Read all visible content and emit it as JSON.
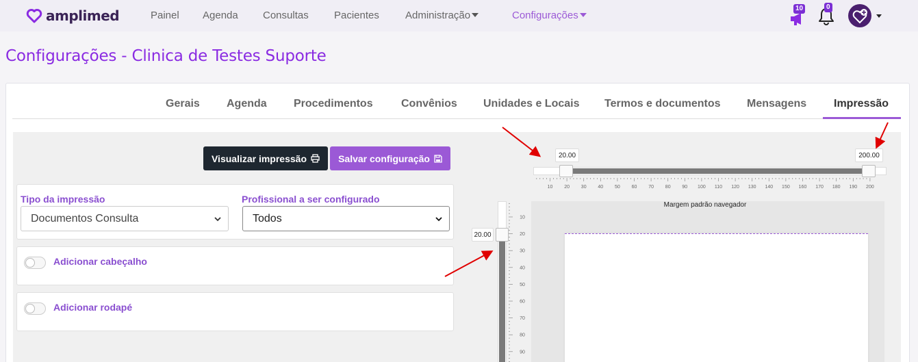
{
  "brand": {
    "name": "amplimed",
    "accent": "#9b59d6",
    "dark": "#3a2356"
  },
  "nav": {
    "items": [
      {
        "label": "Painel"
      },
      {
        "label": "Agenda"
      },
      {
        "label": "Consultas"
      },
      {
        "label": "Pacientes"
      },
      {
        "label": "Administração"
      },
      {
        "label": "Configurações"
      }
    ],
    "active": "Configurações",
    "campaign_badge": "10",
    "notification_badge": "0",
    "icons": [
      "megaphone-icon",
      "bell-icon",
      "user-avatar-icon",
      "caret-down-icon"
    ]
  },
  "page": {
    "title": "Configurações - Clinica de Testes Suporte"
  },
  "tabs": {
    "items": [
      {
        "label": "Gerais"
      },
      {
        "label": "Agenda"
      },
      {
        "label": "Procedimentos"
      },
      {
        "label": "Convênios"
      },
      {
        "label": "Unidades e Locais"
      },
      {
        "label": "Termos e documentos"
      },
      {
        "label": "Mensagens"
      },
      {
        "label": "Impressão"
      }
    ],
    "active": "Impressão"
  },
  "actions": {
    "preview_label": "Visualizar impressão",
    "save_label": "Salvar configuração"
  },
  "form": {
    "print_type_label": "Tipo da impressão",
    "print_type_value": "Documentos Consulta",
    "professional_label": "Profissional a ser configurado",
    "professional_value": "Todos",
    "header_toggle_label": "Adicionar cabeçalho",
    "header_enabled": false,
    "footer_toggle_label": "Adicionar rodapé",
    "footer_enabled": false
  },
  "print_preview": {
    "horizontal_left": "20.00",
    "horizontal_right": "200.00",
    "vertical_top": "20.00",
    "margin_caption": "Margem padrão navegador",
    "h_ticks": [
      "10",
      "20",
      "30",
      "40",
      "50",
      "60",
      "70",
      "80",
      "90",
      "100",
      "110",
      "120",
      "130",
      "140",
      "150",
      "160",
      "170",
      "180",
      "190",
      "200"
    ],
    "v_ticks": [
      "10",
      "20",
      "30",
      "40",
      "50",
      "60",
      "70",
      "80",
      "90"
    ]
  }
}
